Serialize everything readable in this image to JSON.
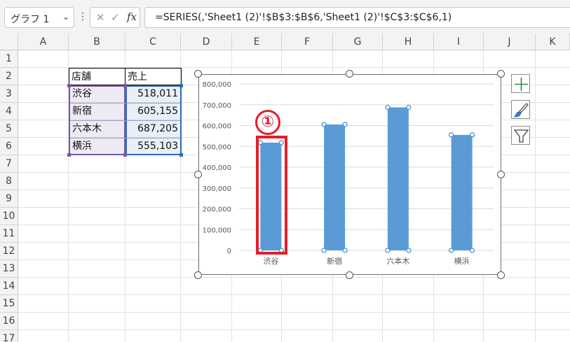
{
  "formula_bar": {
    "name_box": "グラフ 1",
    "name_box_caret": "⌄",
    "kebab": "⋮",
    "cancel_glyph": "✕",
    "enter_glyph": "✓",
    "fx_label": "fx",
    "formula": "=SERIES(,'Sheet1 (2)'!$B$3:$B$6,'Sheet1 (2)'!$C$3:$C$6,1)"
  },
  "grid": {
    "columns": [
      "A",
      "B",
      "C",
      "D",
      "E",
      "F",
      "G",
      "H",
      "I",
      "J",
      "K"
    ],
    "rows": [
      "1",
      "2",
      "3",
      "4",
      "5",
      "6",
      "7",
      "8",
      "9",
      "10",
      "11",
      "12",
      "13",
      "14",
      "15",
      "16",
      "17"
    ]
  },
  "table": {
    "headers": [
      "店舗",
      "売上"
    ],
    "rows": [
      {
        "store": "渋谷",
        "sales": "518,011"
      },
      {
        "store": "新宿",
        "sales": "605,155"
      },
      {
        "store": "六本木",
        "sales": "687,205"
      },
      {
        "store": "横浜",
        "sales": "555,103"
      }
    ]
  },
  "chart_data": {
    "type": "bar",
    "categories": [
      "渋谷",
      "新宿",
      "六本木",
      "横浜"
    ],
    "values": [
      518011,
      605155,
      687205,
      555103
    ],
    "title": "",
    "xlabel": "",
    "ylabel": "",
    "ylim": [
      0,
      800000
    ],
    "yticks": [
      "0",
      "100,000",
      "200,000",
      "300,000",
      "400,000",
      "500,000",
      "600,000",
      "700,000",
      "800,000"
    ],
    "grid": true,
    "legend": "none",
    "bar_color": "#5b9bd5"
  },
  "chart_buttons": {
    "elements_icon": "plus-icon",
    "styles_icon": "brush-icon",
    "filter_icon": "filter-icon"
  },
  "annotation": {
    "number": "①",
    "color": "#e0202a"
  }
}
